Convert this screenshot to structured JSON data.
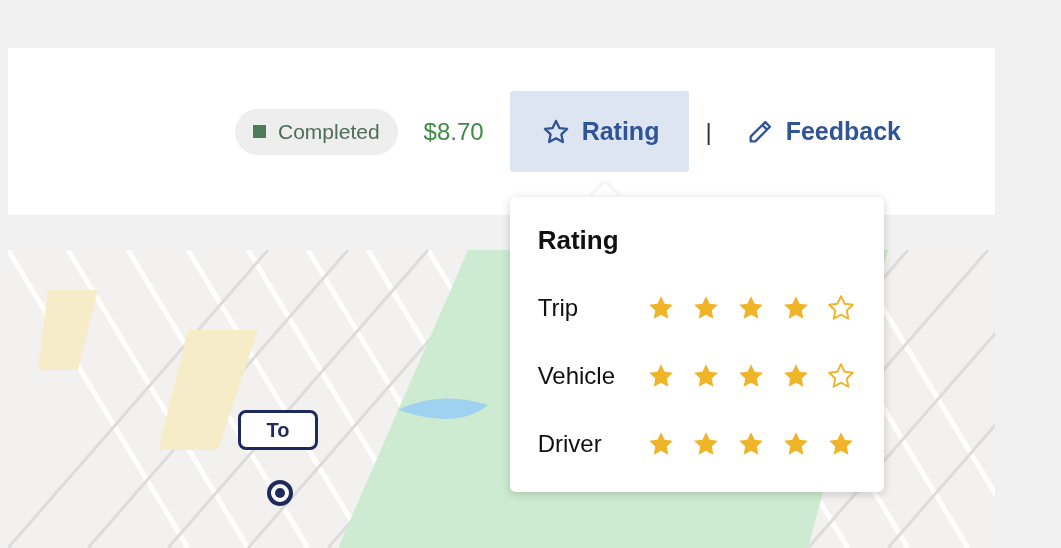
{
  "status": {
    "label": "Completed"
  },
  "price": "$8.70",
  "actions": [
    {
      "label": "Rating",
      "kind": "star",
      "selected": true
    },
    {
      "label": "Feedback",
      "kind": "pencil",
      "selected": false
    }
  ],
  "separator": "|",
  "rating_popover": {
    "title": "Rating",
    "rows": [
      {
        "label": "Trip",
        "stars": 4
      },
      {
        "label": "Vehicle",
        "stars": 4
      },
      {
        "label": "Driver",
        "stars": 5
      }
    ]
  },
  "map": {
    "marker": {
      "label": "To"
    }
  }
}
